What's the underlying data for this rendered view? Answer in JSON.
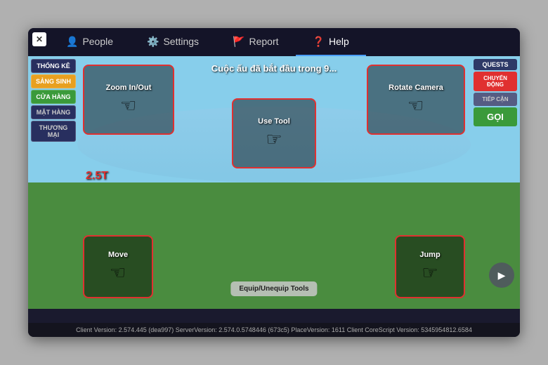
{
  "window": {
    "close_label": "✕"
  },
  "tabs": [
    {
      "id": "people",
      "label": "People",
      "icon": "👤",
      "active": false
    },
    {
      "id": "settings",
      "label": "Settings",
      "icon": "⚙️",
      "active": false
    },
    {
      "id": "report",
      "label": "Report",
      "icon": "🚩",
      "active": false
    },
    {
      "id": "help",
      "label": "Help",
      "icon": "❓",
      "active": true
    }
  ],
  "announcement": "Cuộc ấu đã bắt đầu trong 9...",
  "left_sidebar": {
    "items": [
      {
        "id": "thong-ke",
        "label": "THỐNG KÊ",
        "style": "thong-ke"
      },
      {
        "id": "sang-sinh",
        "label": "SẢNG SINH",
        "style": "sang-sinh"
      },
      {
        "id": "cua-hang",
        "label": "CỬA HÀNG",
        "style": "cua-hang"
      },
      {
        "id": "mat-hang",
        "label": "MẶT HÀNG",
        "style": "mat-hang"
      },
      {
        "id": "thuong-mai",
        "label": "THƯƠNG MẠI",
        "style": "thuong-mai"
      }
    ]
  },
  "right_sidebar": {
    "quest_label": "QUESTS",
    "items": [
      {
        "id": "chuyen-dong",
        "label": "CHUYỂN ĐỘNG",
        "style": "chuyen-dong"
      },
      {
        "id": "tiep-can",
        "label": "TIẾP CẬN",
        "style": "tiep-can"
      },
      {
        "id": "goi",
        "label": "GỌI",
        "style": "goi"
      }
    ]
  },
  "controls": {
    "zoom": "Zoom In/Out",
    "rotate": "Rotate Camera",
    "use_tool": "Use Tool",
    "equip": "Equip/Unequip Tools",
    "move": "Move",
    "jump": "Jump"
  },
  "price": "2.5T",
  "status_bar": "Client Version: 2.574.445 (dea997)   ServerVersion: 2.574.0.5748446 (673c5)   PlaceVersion: 1611   Client CoreScript Version: 5345954812.6584"
}
